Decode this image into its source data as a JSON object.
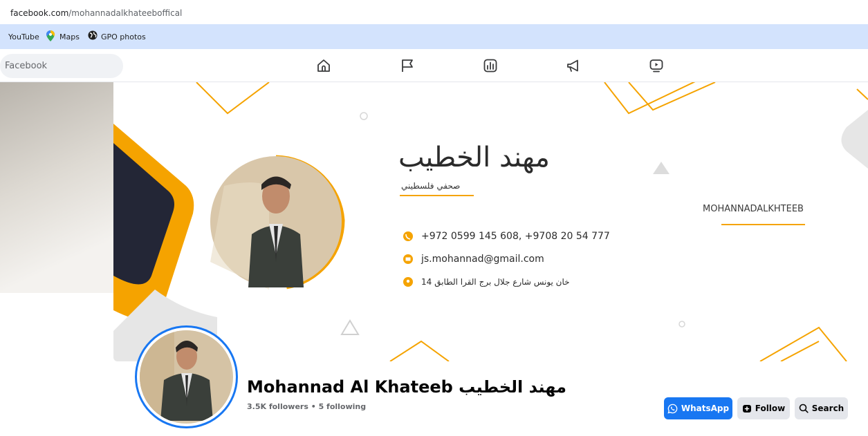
{
  "browser": {
    "url_host": "facebook.com",
    "url_path": "/mohannadalkhateeboffical"
  },
  "bookmarks": [
    {
      "label": "YouTube"
    },
    {
      "label": "Maps"
    },
    {
      "label": "GPO photos"
    }
  ],
  "nav": {
    "search_placeholder": "Facebook",
    "icons": [
      "home-icon",
      "flag-icon",
      "dashboard-icon",
      "megaphone-icon",
      "video-icon"
    ]
  },
  "cover": {
    "arabic_name": "مهند الخطيب",
    "arabic_subtitle": "صحفي فلسطيني",
    "phone": "+972 0599 145 608, +9708 20 54 777",
    "email": "js.mohannad@gmail.com",
    "address": "خان يونس شارع جلال برج القرا الطابق 14",
    "handle": "MOHANNADALKHTEEB",
    "accent_color": "#f5a300"
  },
  "profile": {
    "name": "Mohannad Al Khateeb مهند الخطيب",
    "stats": "3.5K followers • 5 following"
  },
  "actions": {
    "whatsapp": "WhatsApp",
    "follow": "Follow",
    "search": "Search"
  },
  "colors": {
    "facebook_blue": "#1877f2",
    "bookmark_bar": "#d3e3fd",
    "button_gray": "#e4e6eb"
  }
}
